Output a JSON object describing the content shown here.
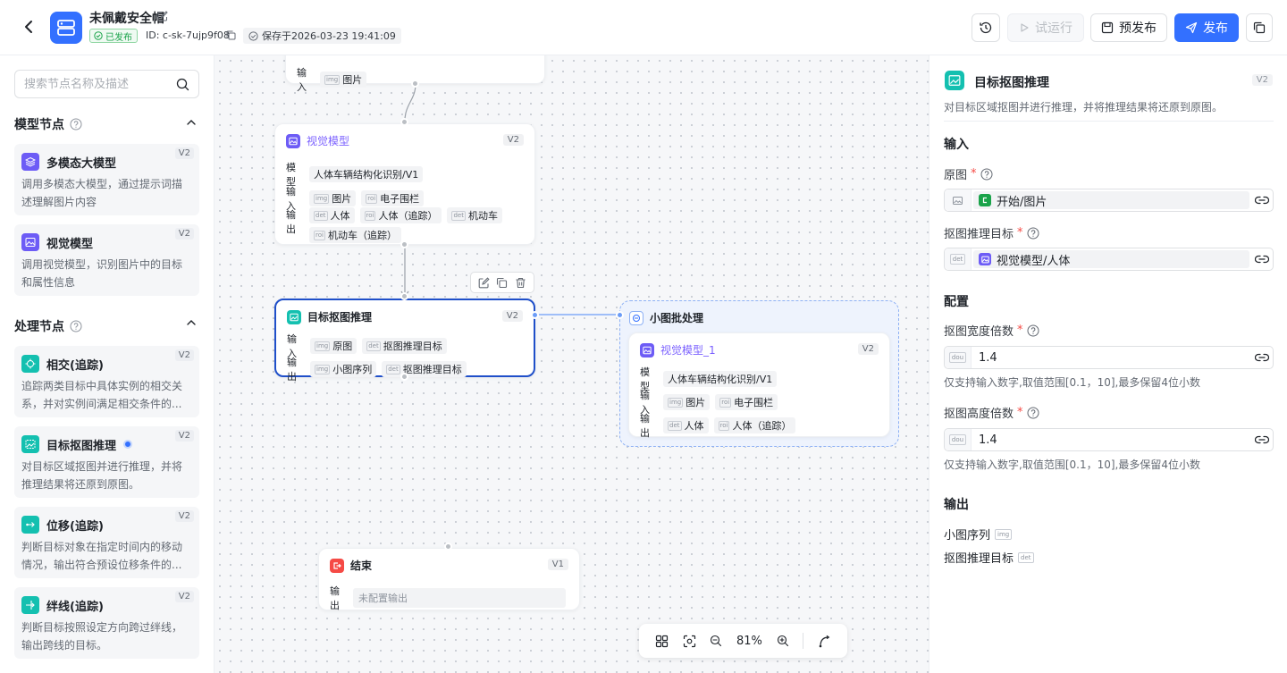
{
  "header": {
    "title": "未佩戴安全帽",
    "status": "已发布",
    "id": "ID: c-sk-7ujp9f08",
    "saved": "保存于2026-03-23 19:41:09",
    "buttons": {
      "test_run": "试运行",
      "prepublish": "预发布",
      "publish": "发布"
    }
  },
  "sidebar": {
    "search_placeholder": "搜索节点名称及描述",
    "model_section": "模型节点",
    "process_section": "处理节点",
    "model_nodes": [
      {
        "name": "多模态大模型",
        "version": "V2",
        "desc": "调用多模态大模型，通过提示词描述理解图片内容",
        "icon": "layers-icon"
      },
      {
        "name": "视觉模型",
        "version": "V2",
        "desc": "调用视觉模型，识别图片中的目标和属性信息",
        "icon": "image-icon"
      }
    ],
    "process_nodes": [
      {
        "name": "相交(追踪)",
        "version": "V2",
        "desc": "追踪两类目标中具体实例的相交关系，并对实例间满足相交条件的...",
        "icon": "intersect-icon"
      },
      {
        "name": "目标抠图推理",
        "version": "V2",
        "desc": "对目标区域抠图并进行推理，并将推理结果将还原到原图。",
        "icon": "crop-icon"
      },
      {
        "name": "位移(追踪)",
        "version": "V2",
        "desc": "判断目标对象在指定时间内的移动情况，输出符合预设位移条件的...",
        "icon": "move-icon"
      },
      {
        "name": "绊线(追踪)",
        "version": "V2",
        "desc": "判断目标按照设定方向跨过绊线，输出跨线的目标。",
        "icon": "tripwire-icon"
      }
    ]
  },
  "canvas": {
    "start_node": {
      "input_label": "输入",
      "input_value": "图片"
    },
    "vision_node": {
      "title": "视觉模型",
      "version": "V2",
      "model_label": "模型",
      "model_value": "人体车辆结构化识别/V1",
      "input_label": "输入",
      "inputs": [
        "图片",
        "电子围栏"
      ],
      "output_label": "输出",
      "outputs": [
        "人体",
        "人体（追踪）",
        "机动车",
        "机动车（追踪）"
      ]
    },
    "crop_node": {
      "title": "目标抠图推理",
      "version": "V2",
      "input_label": "输入",
      "inputs": [
        "原图",
        "抠图推理目标"
      ],
      "output_label": "输出",
      "outputs": [
        "小图序列",
        "抠图推理目标"
      ]
    },
    "batch_group": {
      "title": "小图批处理"
    },
    "vision_node_1": {
      "title": "视觉模型_1",
      "version": "V2",
      "model_label": "模型",
      "model_value": "人体车辆结构化识别/V1",
      "input_label": "输入",
      "inputs": [
        "图片",
        "电子围栏"
      ],
      "output_label": "输出",
      "outputs": [
        "人体",
        "人体（追踪）"
      ]
    },
    "end_node": {
      "title": "结束",
      "version": "V1",
      "output_label": "输出",
      "output_value": "未配置输出"
    },
    "zoom": "81%",
    "type_tags": {
      "img": "img",
      "det": "det",
      "roi": "roi"
    }
  },
  "panel": {
    "title": "目标抠图推理",
    "version": "V2",
    "desc": "对目标区域抠图并进行推理，并将推理结果将还原到原图。",
    "input_section": "输入",
    "source_label": "原图",
    "source_value": "开始/图片",
    "target_label": "抠图推理目标",
    "target_value": "视觉模型/人体",
    "config_section": "配置",
    "width_label": "抠图宽度倍数",
    "width_value": "1.4",
    "width_hint": "仅支持输入数字,取值范围[0.1，10],最多保留4位小数",
    "height_label": "抠图高度倍数",
    "height_value": "1.4",
    "height_hint": "仅支持输入数字,取值范围[0.1，10],最多保留4位小数",
    "output_section": "输出",
    "outputs": [
      "小图序列",
      "抠图推理目标"
    ],
    "type_det": "det",
    "type_dou": "dou",
    "type_img": "img"
  },
  "colors": {
    "accent": "#3370ff",
    "published": "#1aa34a",
    "required": "#f54a45",
    "selected_border": "#1f4fc9"
  }
}
